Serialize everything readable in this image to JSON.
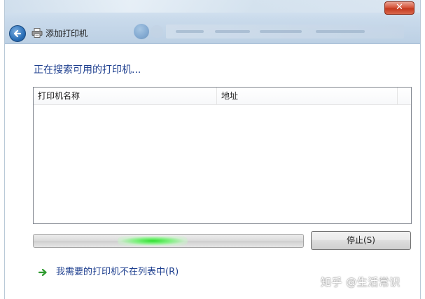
{
  "window": {
    "title": "添加打印机",
    "close_label": "✕"
  },
  "main": {
    "heading": "正在搜索可用的打印机...",
    "list": {
      "columns": [
        "打印机名称",
        "地址"
      ],
      "rows": []
    },
    "progress": {
      "state": "indeterminate"
    },
    "stop_button_label": "停止(S)",
    "printer_not_listed_link": "我需要的打印机不在列表中(R)"
  },
  "watermark": {
    "text": "知乎 @生活常识"
  },
  "colors": {
    "heading_blue": "#1e3f8f",
    "link_arrow_green": "#2e9a2e",
    "progress_glow": "#2fe02f",
    "close_red": "#c43a1f"
  },
  "icons": {
    "back": "back-arrow-icon",
    "printer": "printer-icon",
    "link_arrow": "green-arrow-icon"
  }
}
